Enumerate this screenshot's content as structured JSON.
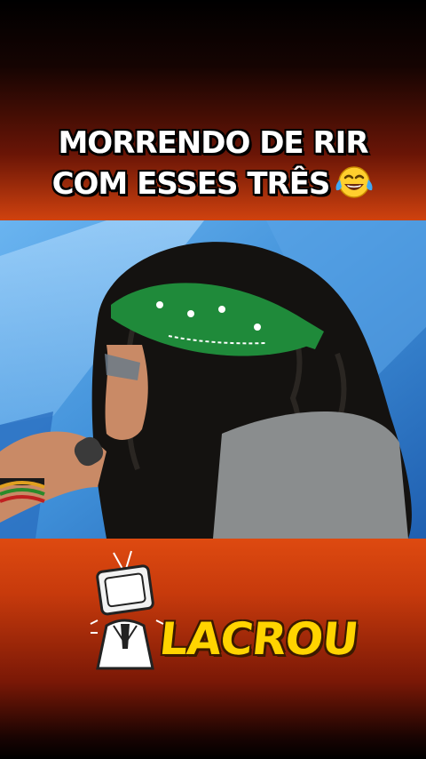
{
  "caption": {
    "line1": "MORRENDO DE RIR",
    "line2": "COM ESSES TRÊS",
    "emoji": "face-with-tears-of-joy-icon"
  },
  "video": {
    "scene": "person-with-green-bandana-singing-into-microphone"
  },
  "brand": {
    "name": "LACROU",
    "mascot": "tv-head-mascot-icon"
  },
  "colors": {
    "band_orange": "#d0420f",
    "brand_yellow": "#ffd400",
    "bandana_green": "#1f8a3a",
    "studio_blue": "#3f8fd8"
  }
}
